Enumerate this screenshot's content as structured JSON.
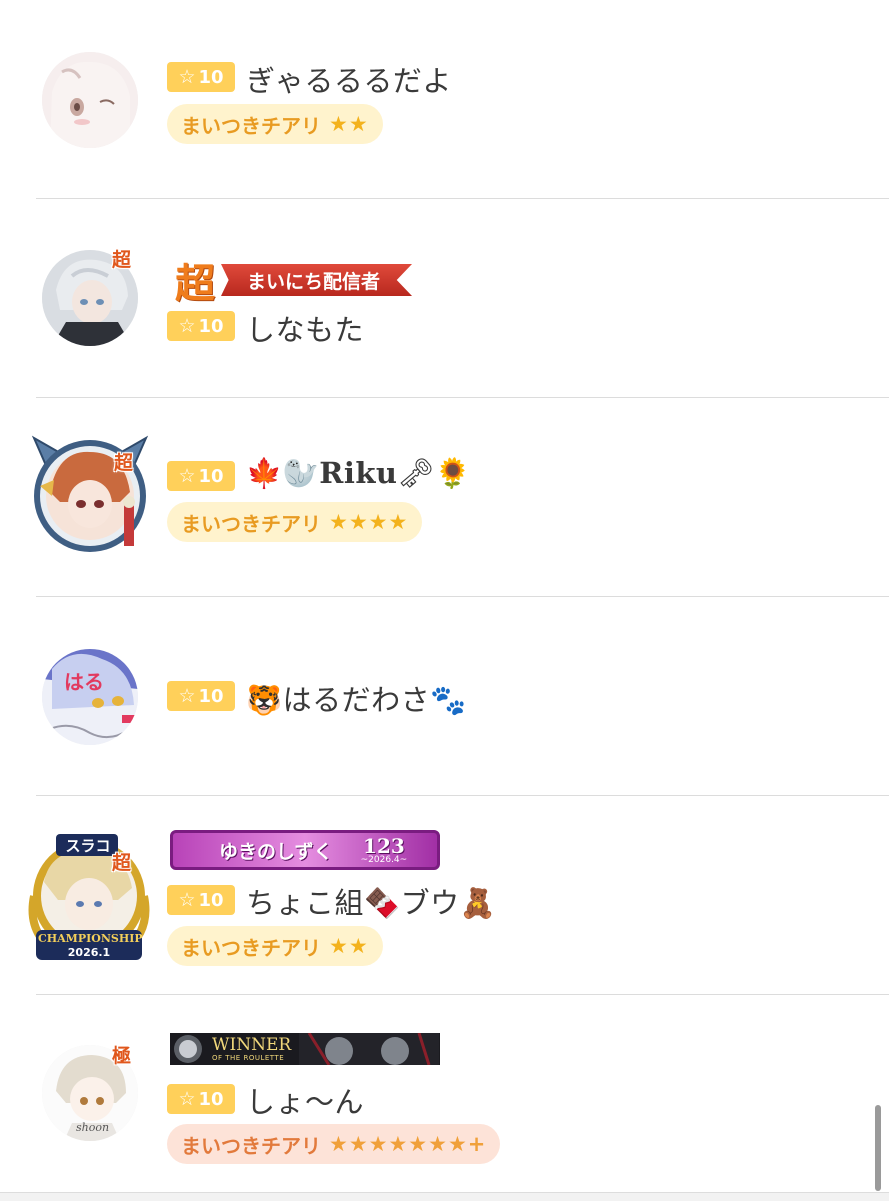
{
  "rows": [
    {
      "level": "10",
      "name": "ぎゃるるるだよ",
      "pill": {
        "label": "まいつきチアリ",
        "stars": "★★"
      }
    },
    {
      "cho_badge": "超",
      "ribbon": {
        "prefix": "超",
        "label": "まいにち配信者"
      },
      "level": "10",
      "name": "しなもた"
    },
    {
      "cho_badge": "超",
      "level": "10",
      "name_prefix": "🍁🦭",
      "name_latin": "Riku",
      "name_suffix": "🗝🌻",
      "pill": {
        "label": "まいつきチアリ",
        "stars": "★★★★"
      }
    },
    {
      "level": "10",
      "name_prefix": "🐯",
      "name": "はるだわさ",
      "name_suffix": "🐾"
    },
    {
      "frame_top": "スラコ",
      "cho_badge": "超",
      "frame_bottom_title": "CHAMPIONSHIP",
      "frame_bottom_date": "2026.1",
      "purple_badge": {
        "name": "ゆきのしずく",
        "number": "123",
        "date": "~2026.4~"
      },
      "level": "10",
      "name": "ちょこ組🍫ブウ🧸",
      "pill": {
        "label": "まいつきチアリ",
        "stars": "★★"
      }
    },
    {
      "cho_badge": "極",
      "winner_badge": {
        "title": "WINNER",
        "subtitle": "OF THE ROULETTE"
      },
      "level": "10",
      "name": "しょ〜ん",
      "pill": {
        "label": "まいつきチアリ",
        "stars": "★★★★★★★+"
      },
      "avatar_text": "shoon"
    }
  ],
  "level_icon": "star-outline-icon",
  "colors": {
    "level_bg": "#ffd05a",
    "pill_bg": "#fff3cd",
    "pill_text": "#e89b22",
    "pill_pink_bg": "#fde3d8",
    "ribbon_red": "#d0382b",
    "purple": "#b843b8"
  }
}
